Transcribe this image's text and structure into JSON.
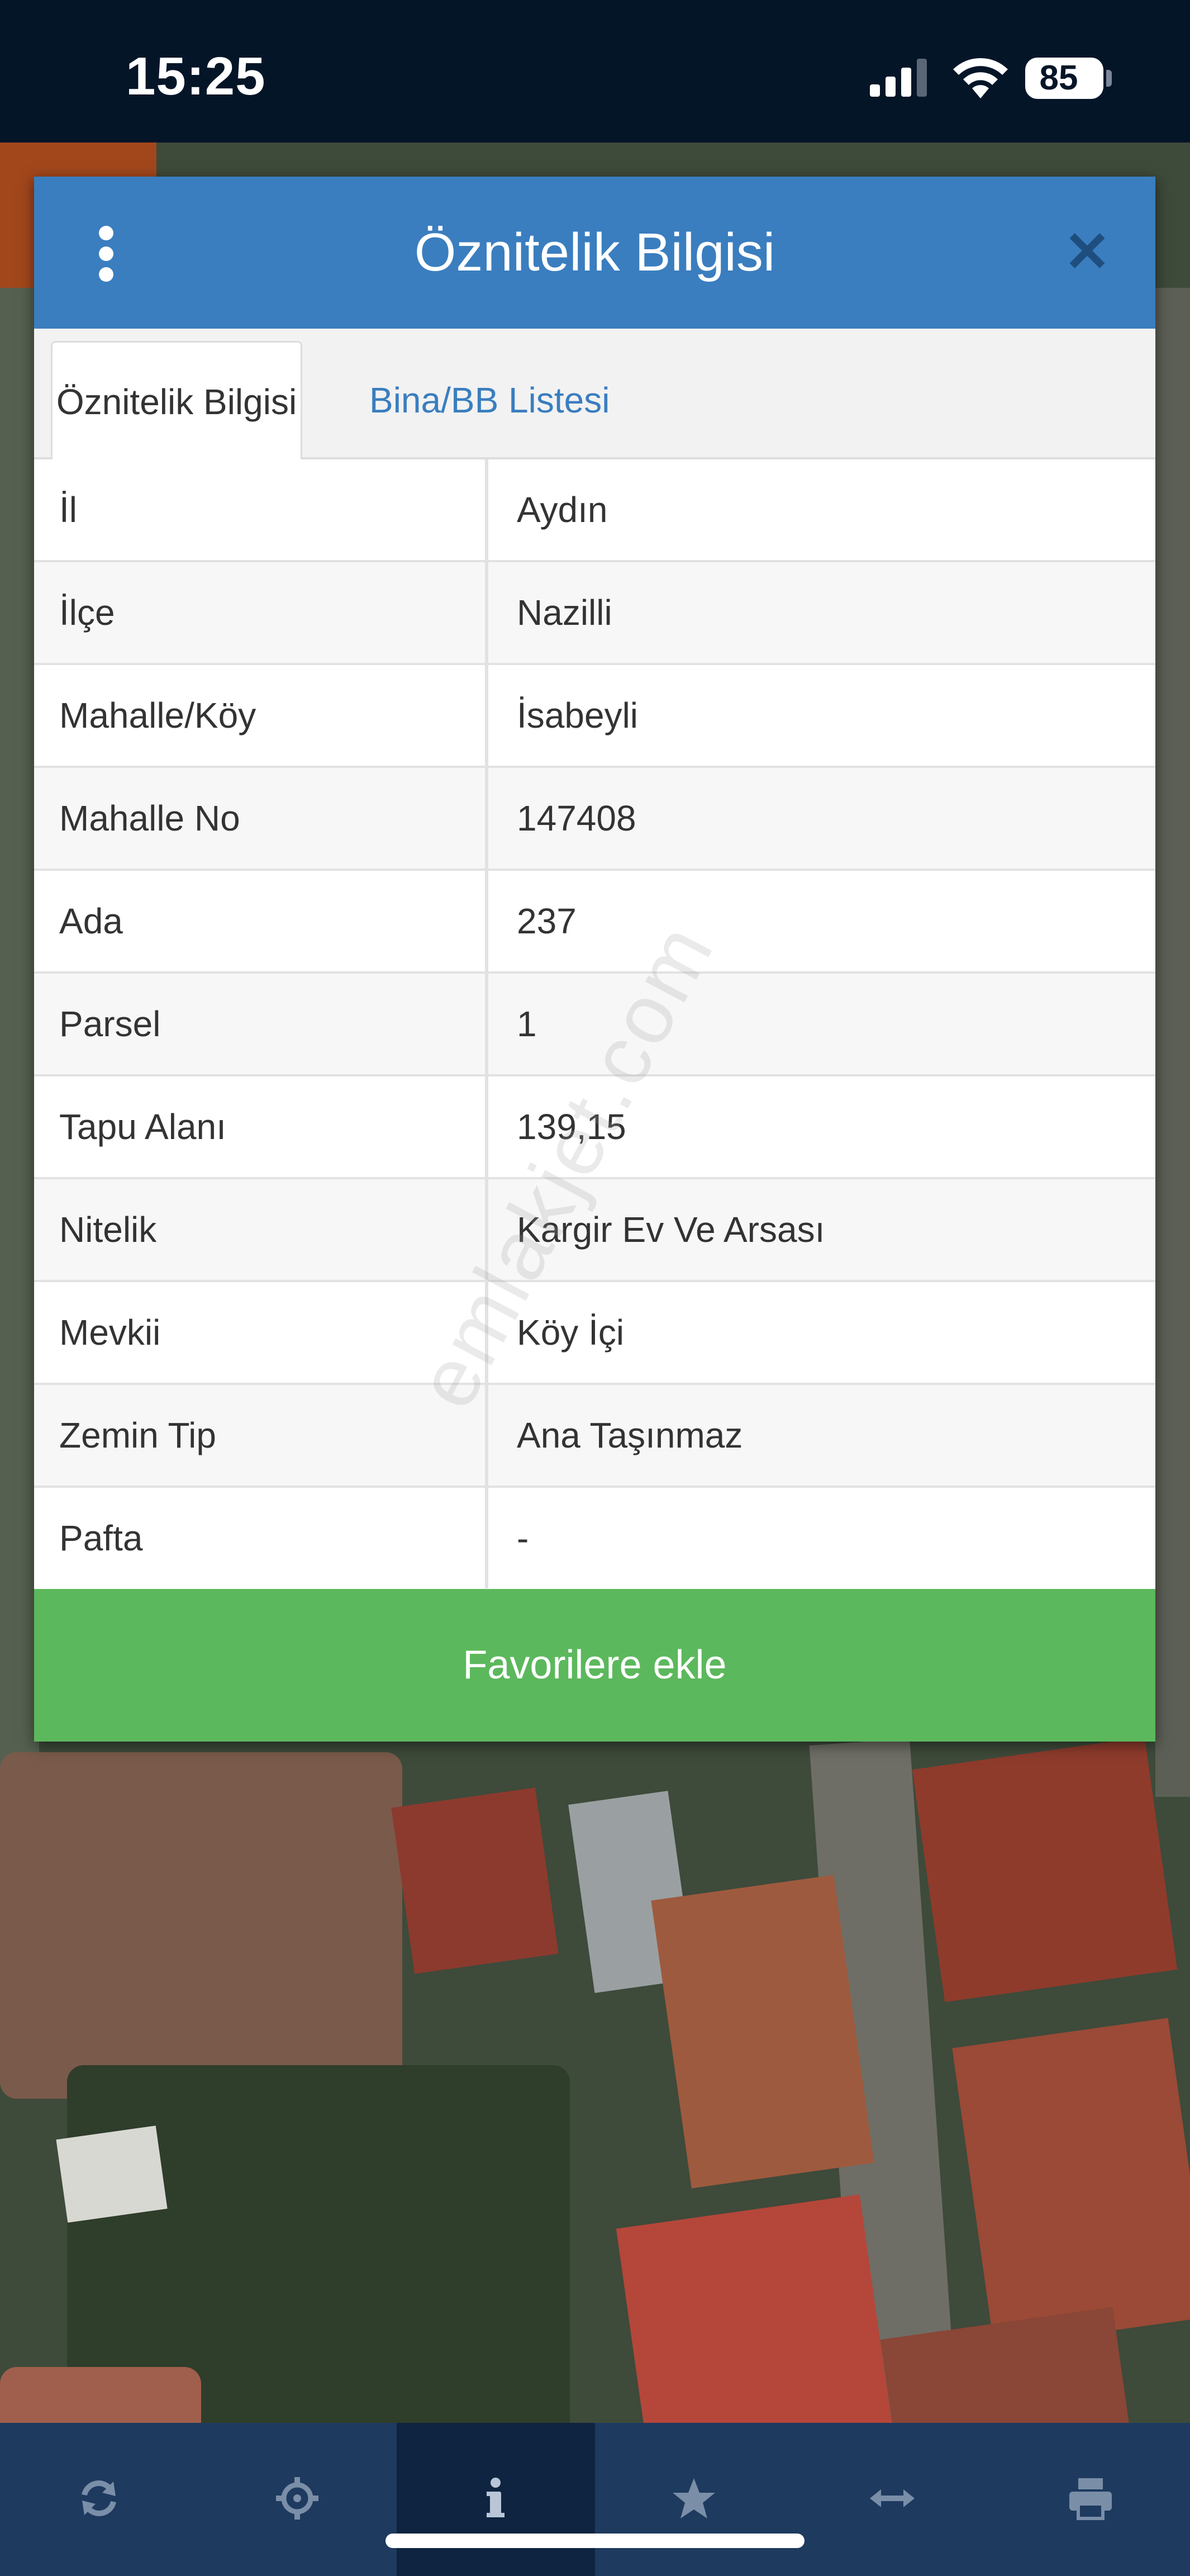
{
  "status_bar": {
    "time": "15:25",
    "battery": "85"
  },
  "dialog": {
    "title": "Öznitelik Bilgisi",
    "menu_icon": "kebab-menu-icon",
    "close_icon": "close-icon",
    "tabs": [
      {
        "label": "Öznitelik Bilgisi",
        "active": true
      },
      {
        "label": "Bina/BB Listesi",
        "active": false
      }
    ],
    "rows": [
      {
        "key": "İl",
        "value": "Aydın"
      },
      {
        "key": "İlçe",
        "value": "Nazilli"
      },
      {
        "key": "Mahalle/Köy",
        "value": "İsabeyli"
      },
      {
        "key": "Mahalle No",
        "value": "147408"
      },
      {
        "key": "Ada",
        "value": "237"
      },
      {
        "key": "Parsel",
        "value": "1"
      },
      {
        "key": "Tapu Alanı",
        "value": "139,15"
      },
      {
        "key": "Nitelik",
        "value": "Kargir Ev Ve Arsası"
      },
      {
        "key": "Mevkii",
        "value": "Köy İçi"
      },
      {
        "key": "Zemin Tip",
        "value": "Ana Taşınmaz"
      },
      {
        "key": "Pafta",
        "value": "-"
      }
    ],
    "favorite_button": "Favorilere ekle"
  },
  "watermark": "emlakjet.com",
  "toolbar": {
    "buttons": [
      {
        "icon": "refresh-icon",
        "active": false
      },
      {
        "icon": "locate-crosshair-icon",
        "active": false
      },
      {
        "icon": "info-icon",
        "active": true
      },
      {
        "icon": "star-icon",
        "active": false
      },
      {
        "icon": "measure-arrows-icon",
        "active": false
      },
      {
        "icon": "print-icon",
        "active": false
      }
    ]
  },
  "colors": {
    "header_blue": "#3a7ebf",
    "button_green": "#5cb85c",
    "toolbar_blue": "#1e3a5f",
    "status_bar": "#051528"
  }
}
